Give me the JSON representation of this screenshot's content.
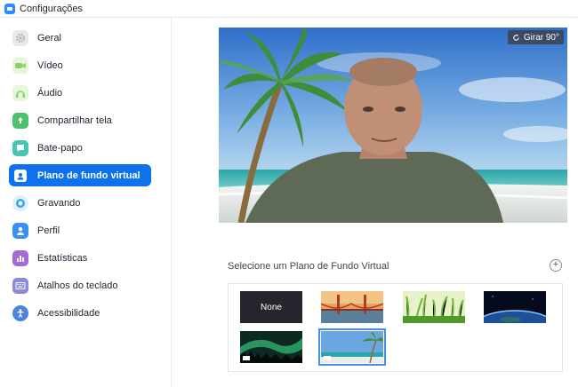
{
  "window": {
    "title": "Configurações"
  },
  "sidebar": {
    "items": [
      {
        "label": "Geral",
        "icon": "gear-icon",
        "color": "#b5b5b5",
        "active": false
      },
      {
        "label": "Vídeo",
        "icon": "video-camera-icon",
        "color": "#8bd26b",
        "active": false
      },
      {
        "label": "Áudio",
        "icon": "headphones-icon",
        "color": "#8bd26b",
        "active": false
      },
      {
        "label": "Compartilhar tela",
        "icon": "share-screen-icon",
        "color": "#4cc26d",
        "active": false
      },
      {
        "label": "Bate-papo",
        "icon": "chat-icon",
        "color": "#47c6b3",
        "active": false
      },
      {
        "label": "Plano de fundo virtual",
        "icon": "virtual-background-icon",
        "color": "#ffffff",
        "active": true
      },
      {
        "label": "Gravando",
        "icon": "record-icon",
        "color": "#35a6e9",
        "active": false
      },
      {
        "label": "Perfil",
        "icon": "profile-icon",
        "color": "#3a8ff0",
        "active": false
      },
      {
        "label": "Estatísticas",
        "icon": "statistics-icon",
        "color": "#a26bd6",
        "active": false
      },
      {
        "label": "Atalhos do teclado",
        "icon": "keyboard-icon",
        "color": "#8b8ad8",
        "active": false
      },
      {
        "label": "Acessibilidade",
        "icon": "accessibility-icon",
        "color": "#4a84e0",
        "active": false
      }
    ]
  },
  "preview": {
    "rotate_label": "Girar 90°"
  },
  "backgrounds": {
    "section_label": "Selecione um Plano de Fundo Virtual",
    "none_label": "None",
    "thumbnails": [
      {
        "name": "None",
        "selected": false
      },
      {
        "name": "golden-gate-bridge",
        "selected": false
      },
      {
        "name": "grass",
        "selected": false
      },
      {
        "name": "earth-from-space",
        "selected": false
      },
      {
        "name": "northern-lights",
        "selected": false,
        "video": true
      },
      {
        "name": "beach-palm",
        "selected": true,
        "video": true
      }
    ]
  },
  "colors": {
    "accent": "#0e72ed"
  }
}
